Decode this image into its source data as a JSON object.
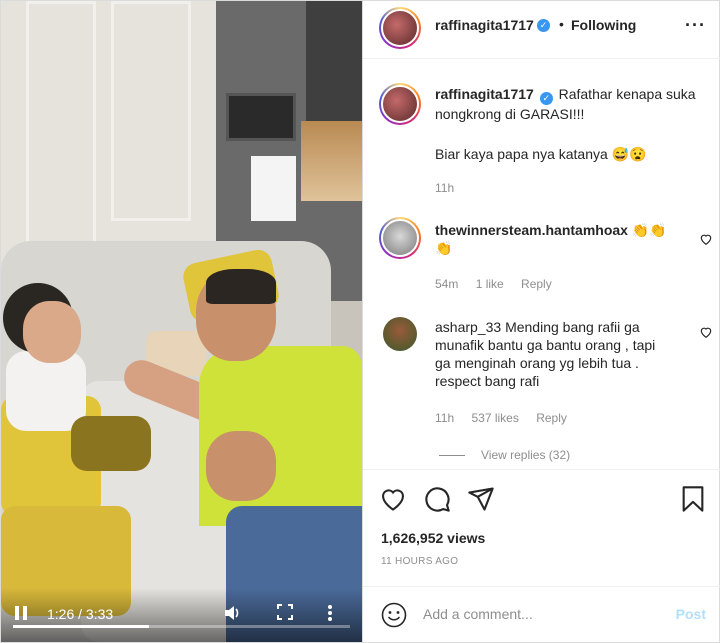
{
  "video": {
    "time": "1:26 / 3:33",
    "progress_fraction": 0.404,
    "icons": [
      "pause-icon",
      "volume-icon",
      "fullscreen-icon",
      "more-vertical-icon"
    ]
  },
  "post": {
    "author": "raffinagita1717",
    "follow_status": "Following",
    "dot": "•",
    "more": "···"
  },
  "caption": {
    "username": "raffinagita1717",
    "line1": "Rafathar kenapa suka",
    "line2": "nongkrong di GARASI!!!",
    "line3": "Biar kaya papa nya katanya",
    "emoji": "😅😧",
    "time": "11h"
  },
  "comments": [
    {
      "username": "thewinnersteam.hantamhoax",
      "emoji1": "👏👏",
      "emoji2": "👏",
      "time": "54m",
      "likes": "1 like",
      "reply": "Reply"
    },
    {
      "username": "asharp_33",
      "line1": "Mending bang rafii ga",
      "line2": "munafik bantu ga bantu orang , tapi",
      "line3": "ga menginah orang yg lebih tua .",
      "line4": "respect bang rafi",
      "time": "11h",
      "likes": "537 likes",
      "reply": "Reply",
      "view_replies": "View replies (32)"
    }
  ],
  "stats": {
    "views": "1,626,952 views",
    "ago": "11 HOURS AGO"
  },
  "add_comment": {
    "placeholder": "Add a comment...",
    "post_label": "Post"
  },
  "colors": {
    "verified": "#3897f0",
    "post_disabled": "#b2dffc",
    "meta": "#8e8e8e"
  }
}
